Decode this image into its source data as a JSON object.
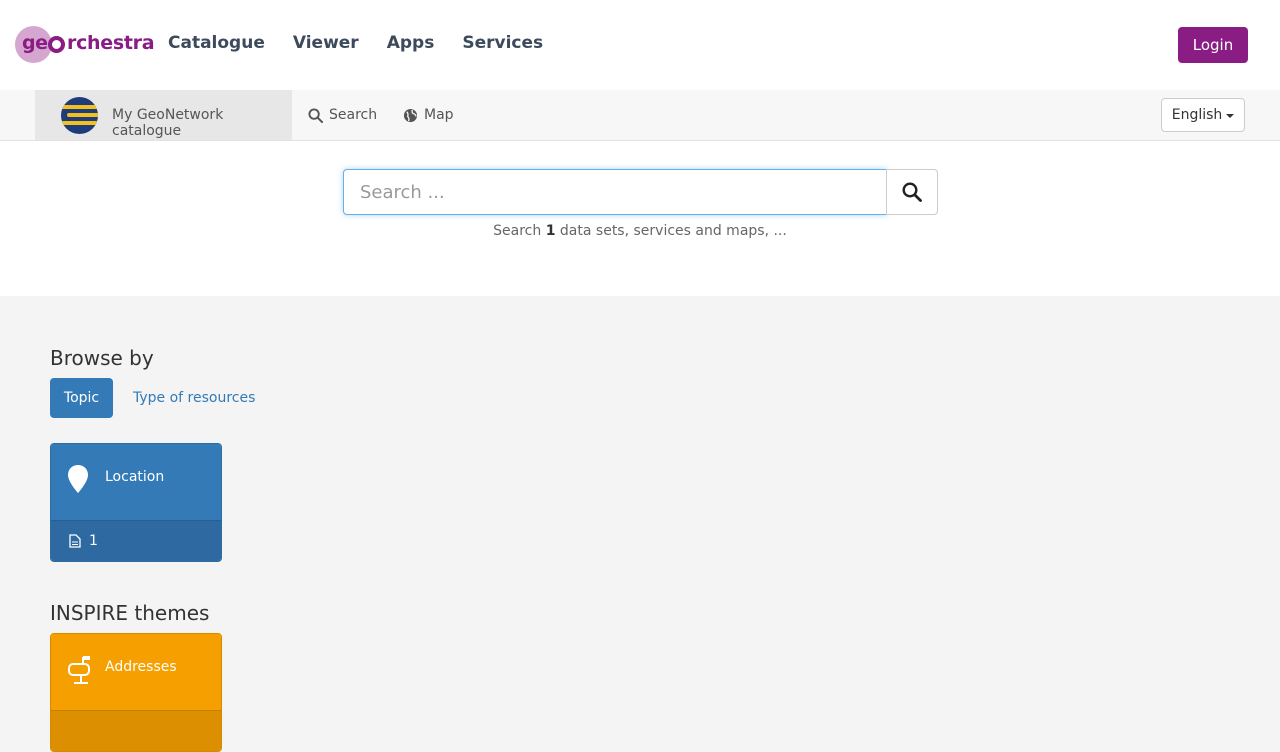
{
  "header": {
    "logo_text_a": "ge",
    "logo_text_b": "rchestra",
    "nav": [
      "Catalogue",
      "Viewer",
      "Apps",
      "Services"
    ],
    "login_label": "Login",
    "brand_color": "#8a1d84"
  },
  "subnav": {
    "brand_label": "My GeoNetwork catalogue",
    "search_label": "Search",
    "map_label": "Map",
    "language": "English"
  },
  "search": {
    "placeholder": "Search ...",
    "hint_prefix": "Search",
    "hint_count": "1",
    "hint_suffix": "data sets, services and maps, ..."
  },
  "browse": {
    "title": "Browse by",
    "tab_topic": "Topic",
    "tab_types": "Type of resources",
    "cards": [
      {
        "label": "Location",
        "count": "1",
        "icon": "map-marker-icon"
      }
    ]
  },
  "inspire": {
    "title": "INSPIRE themes",
    "cards": [
      {
        "label": "Addresses",
        "icon": "mailbox-icon"
      }
    ]
  },
  "colors": {
    "primary": "#337ab7",
    "inspire_accent": "#f5a000"
  }
}
